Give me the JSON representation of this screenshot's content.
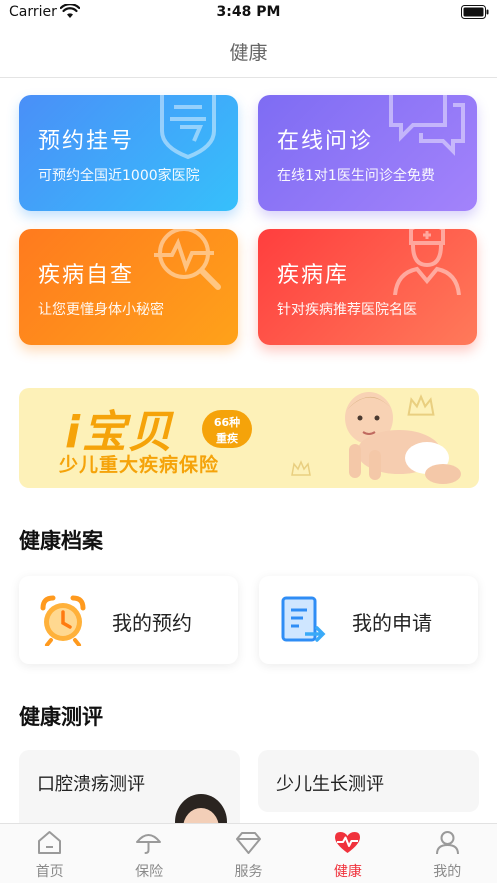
{
  "status_bar": {
    "carrier": "Carrier",
    "time": "3:48 PM"
  },
  "nav": {
    "title": "健康"
  },
  "cards": [
    {
      "title": "预约挂号",
      "subtitle": "可预约全国近1000家医院",
      "icon": "number-sign-icon"
    },
    {
      "title": "在线问诊",
      "subtitle": "在线1对1医生问诊全免费",
      "icon": "chat-bubbles-icon"
    },
    {
      "title": "疾病自查",
      "subtitle": "让您更懂身体小秘密",
      "icon": "pulse-magnifier-icon"
    },
    {
      "title": "疾病库",
      "subtitle": "针对疾病推荐医院名医",
      "icon": "doctor-icon"
    }
  ],
  "banner": {
    "brand": "i宝贝",
    "badge_top": "66种",
    "badge_bottom": "重疾",
    "text": "少儿重大疾病保险"
  },
  "health_records": {
    "title": "健康档案",
    "items": [
      {
        "label": "我的预约",
        "icon": "alarm-clock-icon"
      },
      {
        "label": "我的申请",
        "icon": "document-arrow-icon"
      }
    ]
  },
  "health_eval": {
    "title": "健康测评",
    "items": [
      {
        "label": "口腔溃疡测评"
      },
      {
        "label": "少儿生长测评"
      }
    ]
  },
  "tab_bar": {
    "active_color": "#f0323c",
    "items": [
      {
        "label": "首页",
        "icon": "home-icon"
      },
      {
        "label": "保险",
        "icon": "umbrella-icon"
      },
      {
        "label": "服务",
        "icon": "diamond-icon"
      },
      {
        "label": "健康",
        "icon": "heart-pulse-icon",
        "active": true
      },
      {
        "label": "我的",
        "icon": "person-icon"
      }
    ]
  }
}
